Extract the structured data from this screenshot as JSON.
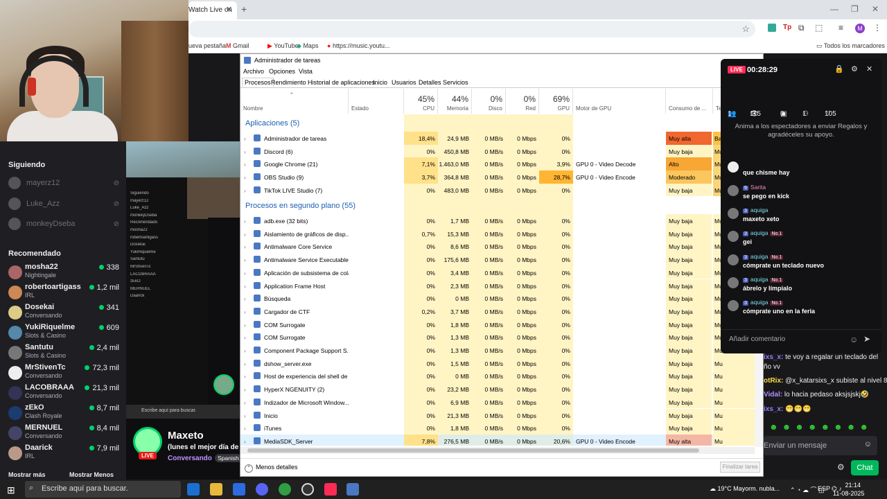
{
  "chrome": {
    "tab_title": "Watch Live on",
    "new_tab_glyph": "+",
    "omnibox_text": "",
    "bookmarks": [
      {
        "label": "ueva pestaña",
        "icon": "new-tab-icon"
      },
      {
        "label": "Gmail",
        "icon": "gmail-icon"
      },
      {
        "label": "YouTube",
        "icon": "youtube-icon"
      },
      {
        "label": "Maps",
        "icon": "maps-icon"
      },
      {
        "label": "https://music.youtu...",
        "icon": "music-icon"
      }
    ],
    "all_bookmarks": "Todos los marcadores",
    "profile_initial": "M"
  },
  "sidebar": {
    "following_title": "Siguiendo",
    "following": [
      {
        "name": "mayerz12"
      },
      {
        "name": "Luke_Azz"
      },
      {
        "name": "monkeyDseba"
      }
    ],
    "recommended_title": "Recomendado",
    "recommended": [
      {
        "name": "mosha22",
        "category": "Nightingale",
        "viewers": "338"
      },
      {
        "name": "robertoartigass",
        "category": "IRL",
        "viewers": "1,2 mil"
      },
      {
        "name": "Dosekai",
        "category": "Conversando",
        "viewers": "341"
      },
      {
        "name": "YukiRiquelme",
        "category": "Slots & Casino",
        "viewers": "609"
      },
      {
        "name": "Santutu",
        "category": "Slots & Casino",
        "viewers": "2,4 mil"
      },
      {
        "name": "MrStivenTc",
        "category": "Conversando",
        "viewers": "72,3 mil"
      },
      {
        "name": "LACOBRAAA",
        "category": "Conversando",
        "viewers": "21,3 mil"
      },
      {
        "name": "zEkO",
        "category": "Clash Royale",
        "viewers": "8,7 mil"
      },
      {
        "name": "MERNUEL",
        "category": "Conversando",
        "viewers": "8,4 mil"
      },
      {
        "name": "Daarick",
        "category": "IRL",
        "viewers": "7,9 mil"
      }
    ],
    "show_more": "Mostrar más",
    "show_less": "Mostrar Menos"
  },
  "preview": {
    "search_text": "Escribe aquí para buscar."
  },
  "profile": {
    "name": "Maxeto",
    "live_badge": "LIVE",
    "status": "(lunes el mejor día de la",
    "category": "Conversando",
    "language": "Spanish"
  },
  "taskmanager": {
    "title": "Administrador de tareas",
    "menu": [
      "Archivo",
      "Opciones",
      "Vista"
    ],
    "tabs": [
      "Procesos",
      "Rendimiento",
      "Historial de aplicaciones",
      "Inicio",
      "Usuarios",
      "Detalles",
      "Servicios"
    ],
    "columns": {
      "name": "Nombre",
      "status": "Estado",
      "cpu_pct": "45%",
      "cpu": "CPU",
      "mem_pct": "44%",
      "mem": "Memoria",
      "disk_pct": "0%",
      "disk": "Disco",
      "net_pct": "0%",
      "net": "Red",
      "gpu_pct": "69%",
      "gpu": "GPU",
      "gpu_engine": "Motor de GPU",
      "power": "Consumo de ...",
      "power_trend": "Te"
    },
    "apps_group": "Aplicaciones (5)",
    "bg_group": "Procesos en segundo plano (55)",
    "apps": [
      {
        "name": "Administrador de tareas",
        "cpu": "18,4%",
        "mem": "24,9 MB",
        "disk": "0 MB/s",
        "net": "0 Mbps",
        "gpu": "0%",
        "engine": "",
        "power": "Muy alta",
        "trend": "Ba"
      },
      {
        "name": "Discord (6)",
        "cpu": "0%",
        "mem": "450,8 MB",
        "disk": "0 MB/s",
        "net": "0 Mbps",
        "gpu": "0%",
        "engine": "",
        "power": "Muy baja",
        "trend": "Mu"
      },
      {
        "name": "Google Chrome (21)",
        "cpu": "7,1%",
        "mem": "1.463,0 MB",
        "disk": "0 MB/s",
        "net": "0 Mbps",
        "gpu": "3,9%",
        "engine": "GPU 0 - Video Decode",
        "power": "Alto",
        "trend": "Mu"
      },
      {
        "name": "OBS Studio (9)",
        "cpu": "3,7%",
        "mem": "364,8 MB",
        "disk": "0 MB/s",
        "net": "0 Mbps",
        "gpu": "28,7%",
        "engine": "GPU 0 - Video Encode",
        "power": "Moderado",
        "trend": "Mu"
      },
      {
        "name": "TikTok LIVE Studio (7)",
        "cpu": "0%",
        "mem": "483,0 MB",
        "disk": "0 MB/s",
        "net": "0 Mbps",
        "gpu": "0%",
        "engine": "",
        "power": "Muy baja",
        "trend": "Mu"
      }
    ],
    "bg": [
      {
        "name": "adb.exe (32 bits)",
        "cpu": "0%",
        "mem": "1,7 MB",
        "disk": "0 MB/s",
        "net": "0 Mbps",
        "gpu": "0%",
        "engine": "",
        "power": "Muy baja",
        "trend": "Mu"
      },
      {
        "name": "Aislamiento de gráficos de disp...",
        "cpu": "0,7%",
        "mem": "15,3 MB",
        "disk": "0 MB/s",
        "net": "0 Mbps",
        "gpu": "0%",
        "engine": "",
        "power": "Muy baja",
        "trend": "Mu"
      },
      {
        "name": "Antimalware Core Service",
        "cpu": "0%",
        "mem": "8,6 MB",
        "disk": "0 MB/s",
        "net": "0 Mbps",
        "gpu": "0%",
        "engine": "",
        "power": "Muy baja",
        "trend": "Mu"
      },
      {
        "name": "Antimalware Service Executable",
        "cpu": "0%",
        "mem": "175,6 MB",
        "disk": "0 MB/s",
        "net": "0 Mbps",
        "gpu": "0%",
        "engine": "",
        "power": "Muy baja",
        "trend": "Mu"
      },
      {
        "name": "Aplicación de subsistema de cola",
        "cpu": "0%",
        "mem": "3,4 MB",
        "disk": "0 MB/s",
        "net": "0 Mbps",
        "gpu": "0%",
        "engine": "",
        "power": "Muy baja",
        "trend": "Mu"
      },
      {
        "name": "Application Frame Host",
        "cpu": "0%",
        "mem": "2,3 MB",
        "disk": "0 MB/s",
        "net": "0 Mbps",
        "gpu": "0%",
        "engine": "",
        "power": "Muy baja",
        "trend": "Mu"
      },
      {
        "name": "Búsqueda",
        "cpu": "0%",
        "mem": "0 MB",
        "disk": "0 MB/s",
        "net": "0 Mbps",
        "gpu": "0%",
        "engine": "",
        "power": "Muy baja",
        "trend": "Mu"
      },
      {
        "name": "Cargador de CTF",
        "cpu": "0,2%",
        "mem": "3,7 MB",
        "disk": "0 MB/s",
        "net": "0 Mbps",
        "gpu": "0%",
        "engine": "",
        "power": "Muy baja",
        "trend": "Mu"
      },
      {
        "name": "COM Surrogate",
        "cpu": "0%",
        "mem": "1,8 MB",
        "disk": "0 MB/s",
        "net": "0 Mbps",
        "gpu": "0%",
        "engine": "",
        "power": "Muy baja",
        "trend": "Mu"
      },
      {
        "name": "COM Surrogate",
        "cpu": "0%",
        "mem": "1,3 MB",
        "disk": "0 MB/s",
        "net": "0 Mbps",
        "gpu": "0%",
        "engine": "",
        "power": "Muy baja",
        "trend": "Mu"
      },
      {
        "name": "Component Package Support S...",
        "cpu": "0%",
        "mem": "1,3 MB",
        "disk": "0 MB/s",
        "net": "0 Mbps",
        "gpu": "0%",
        "engine": "",
        "power": "Muy baja",
        "trend": "Mu"
      },
      {
        "name": "dshow_server.exe",
        "cpu": "0%",
        "mem": "1,5 MB",
        "disk": "0 MB/s",
        "net": "0 Mbps",
        "gpu": "0%",
        "engine": "",
        "power": "Muy baja",
        "trend": "Mu"
      },
      {
        "name": "Host de experiencia del shell de ...",
        "cpu": "0%",
        "mem": "0 MB",
        "disk": "0 MB/s",
        "net": "0 Mbps",
        "gpu": "0%",
        "engine": "",
        "power": "Muy baja",
        "trend": "Mu"
      },
      {
        "name": "HyperX NGENUITY (2)",
        "cpu": "0%",
        "mem": "23,2 MB",
        "disk": "0 MB/s",
        "net": "0 Mbps",
        "gpu": "0%",
        "engine": "",
        "power": "Muy baja",
        "trend": "Mu"
      },
      {
        "name": "Indizador de Microsoft Window...",
        "cpu": "0%",
        "mem": "6,9 MB",
        "disk": "0 MB/s",
        "net": "0 Mbps",
        "gpu": "0%",
        "engine": "",
        "power": "Muy baja",
        "trend": "Mu"
      },
      {
        "name": "Inicio",
        "cpu": "0%",
        "mem": "21,3 MB",
        "disk": "0 MB/s",
        "net": "0 Mbps",
        "gpu": "0%",
        "engine": "",
        "power": "Muy baja",
        "trend": "Mu"
      },
      {
        "name": "iTunes",
        "cpu": "0%",
        "mem": "1,8 MB",
        "disk": "0 MB/s",
        "net": "0 Mbps",
        "gpu": "0%",
        "engine": "",
        "power": "Muy baja",
        "trend": "Mu"
      },
      {
        "name": "MediaSDK_Server",
        "cpu": "7,8%",
        "mem": "276,5 MB",
        "disk": "0 MB/s",
        "net": "0 Mbps",
        "gpu": "20,6%",
        "engine": "GPU 0 - Video Encode",
        "power": "Muy alta",
        "trend": "Mu"
      }
    ],
    "less_details": "Menos detalles",
    "end_task": "Finalizar tarea"
  },
  "overlay": {
    "live": "LIVE",
    "timer": "00:28:29",
    "stats": [
      "1",
      "115",
      "0",
      "1",
      "105"
    ],
    "hint": "Anima a los espectadores a enviar Regalos y agradéceles su apoyo.",
    "messages": [
      {
        "user": "",
        "level": "",
        "badge": "",
        "text": "que chisme hay"
      },
      {
        "user": "Sarita",
        "level": "9",
        "badge": "",
        "text": "se pego en kick"
      },
      {
        "user": "aquiga",
        "level": "3",
        "badge": "",
        "text": "maxeto xeto"
      },
      {
        "user": "aquiga",
        "level": "3",
        "badge": "No.1",
        "text": "gei"
      },
      {
        "user": "aquiga",
        "level": "3",
        "badge": "No.1",
        "text": "cómprate un teclado nuevo"
      },
      {
        "user": "aquiga",
        "level": "3",
        "badge": "No.1",
        "text": "ábrelo y límpialo"
      },
      {
        "user": "aquiga",
        "level": "3",
        "badge": "No.1",
        "text": "cómprate uno en la feria"
      }
    ],
    "input_placeholder": "Añadir comentario"
  },
  "twitch_chat": {
    "lines": [
      {
        "user": "ixs_x:",
        "text": " te voy a regalar un teclado del"
      },
      {
        "user": "",
        "text": "ño vv"
      },
      {
        "user": "otRix:",
        "text": " @x_katarsixs_x subiste al nivel 8"
      },
      {
        "user": "Vidal:",
        "text": " lo hacia pedaso aksjsjskj🤣"
      },
      {
        "user": "ixs_x:",
        "text": " 😁😁😁"
      }
    ],
    "input_placeholder": "Enviar un mensaje",
    "chat_button": "Chat"
  },
  "taskbar": {
    "search": "Escribe aquí para buscar.",
    "weather": "19°C  Mayorm. nubla...",
    "lang": "ESP",
    "time": "21:14",
    "date": "11-08-2025"
  }
}
